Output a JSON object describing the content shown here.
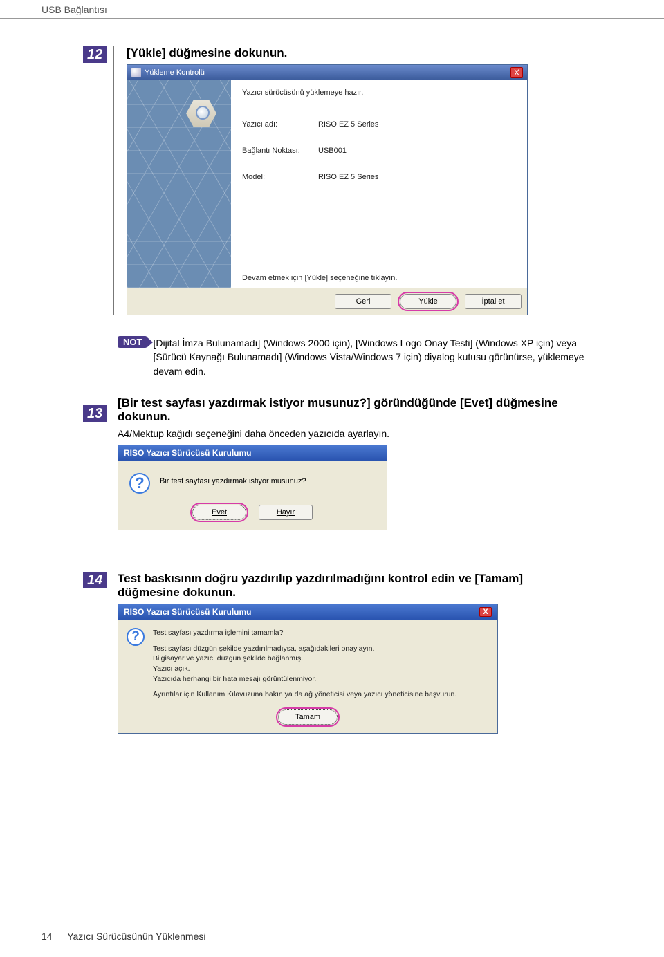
{
  "header": {
    "section_title": "USB Bağlantısı"
  },
  "steps": {
    "s12": {
      "num": "12",
      "title": "[Yükle] düğmesine dokunun."
    },
    "note": {
      "badge": "NOT",
      "text": "[Dijital İmza Bulunamadı] (Windows 2000 için), [Windows Logo Onay Testi] (Windows XP için) veya [Sürücü Kaynağı Bulunamadı] (Windows Vista/Windows 7 için) diyalog kutusu görünürse, yüklemeye devam edin."
    },
    "s13": {
      "num": "13",
      "title": "[Bir test sayfası yazdırmak istiyor musunuz?] göründüğünde [Evet] düğmesine dokunun.",
      "sub": "A4/Mektup kağıdı seçeneğini daha önceden yazıcıda ayarlayın."
    },
    "s14": {
      "num": "14",
      "title": "Test baskısının doğru yazdırılıp yazdırılmadığını kontrol edin ve [Tamam] düğmesine dokunun."
    }
  },
  "dialog1": {
    "title": "Yükleme Kontrolü",
    "close": "X",
    "ready_text": "Yazıcı sürücüsünü yüklemeye hazır.",
    "fields": {
      "printer_label": "Yazıcı adı:",
      "printer_value": "RISO EZ 5 Series",
      "port_label": "Bağlantı Noktası:",
      "port_value": "USB001",
      "model_label": "Model:",
      "model_value": "RISO EZ 5 Series"
    },
    "footer_line": "Devam etmek için [Yükle] seçeneğine tıklayın.",
    "buttons": {
      "back": "Geri",
      "install": "Yükle",
      "cancel": "İptal et"
    }
  },
  "dialog2": {
    "title": "RISO Yazıcı Sürücüsü Kurulumu",
    "question_mark": "?",
    "message": "Bir test sayfası yazdırmak istiyor musunuz?",
    "buttons": {
      "yes": "Evet",
      "no": "Hayır"
    }
  },
  "dialog3": {
    "title": "RISO Yazıcı Sürücüsü Kurulumu",
    "close": "X",
    "question_mark": "?",
    "lines": {
      "l1": "Test sayfası yazdırma işlemini tamamla?",
      "l2": "Test sayfası düzgün şekilde yazdırılmadıysa, aşağıdakileri onaylayın.",
      "l3": "Bilgisayar ve yazıcı düzgün şekilde bağlanmış.",
      "l4": "Yazıcı açık.",
      "l5": "Yazıcıda herhangi bir hata mesajı görüntülenmiyor.",
      "l6": "Ayrıntılar için Kullanım Kılavuzuna bakın ya da ağ yöneticisi veya yazıcı yöneticisine başvurun."
    },
    "buttons": {
      "ok": "Tamam"
    }
  },
  "footer": {
    "page_number": "14",
    "doc_title": "Yazıcı Sürücüsünün Yüklenmesi"
  }
}
